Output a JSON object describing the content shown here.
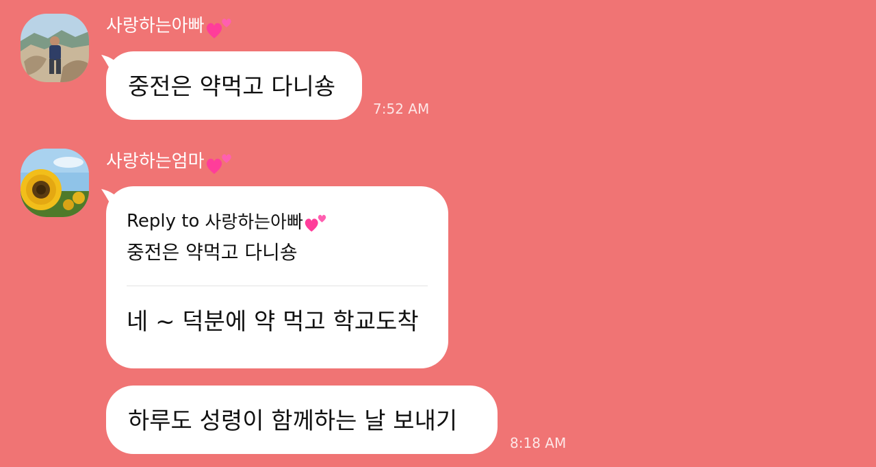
{
  "theme": {
    "background": "#f07474",
    "bubble": "#ffffff",
    "heart": "#ff3d9a"
  },
  "messages": [
    {
      "sender": "사랑하는아빠",
      "sender_emoji": "two-hearts-icon",
      "text": "중전은 약먹고 다니숑",
      "time": "7:52 AM"
    },
    {
      "sender": "사랑하는엄마",
      "sender_emoji": "two-hearts-icon",
      "reply": {
        "prefix": "Reply to",
        "to_sender": "사랑하는아빠",
        "quoted_text": "중전은 약먹고 다니숑"
      },
      "text": "네 ~ 덕분에 약 먹고 학교도착"
    },
    {
      "text": "하루도 성령이 함께하는 날 보내기",
      "time": "8:18 AM"
    }
  ]
}
